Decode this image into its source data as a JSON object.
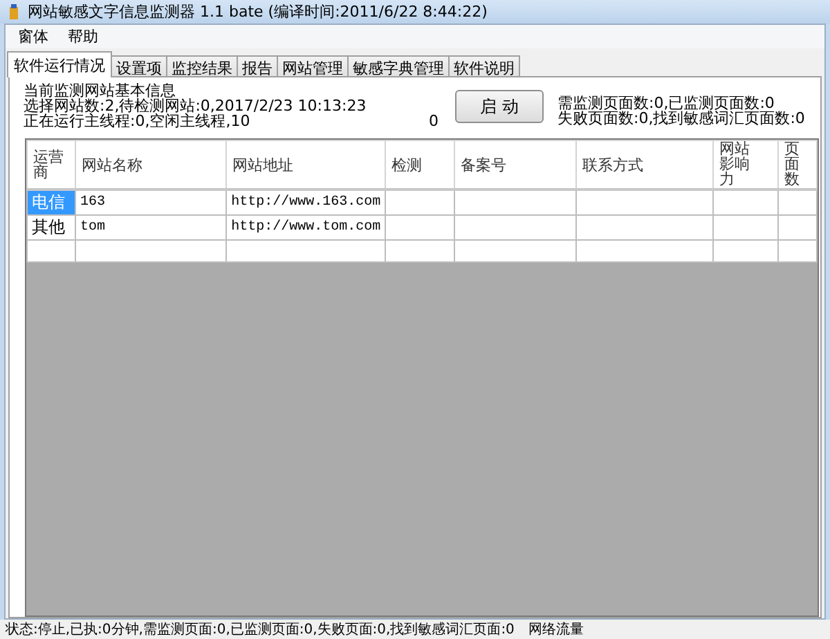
{
  "window": {
    "title": "网站敏感文字信息监测器 1.1 bate (编译时间:2011/6/22 8:44:22)"
  },
  "menu": [
    "窗体",
    "帮助"
  ],
  "tabs": [
    {
      "label": "软件运行情况",
      "selected": true
    },
    {
      "label": "设置项",
      "selected": false
    },
    {
      "label": "监控结果",
      "selected": false
    },
    {
      "label": "报告",
      "selected": false
    },
    {
      "label": "网站管理",
      "selected": false
    },
    {
      "label": "敏感字典管理",
      "selected": false
    },
    {
      "label": "软件说明",
      "selected": false
    }
  ],
  "info": {
    "heading": "当前监测网站基本信息",
    "line_1": "选择网站数:2,待检测网站:0,2017/2/23 10:13:23",
    "line_2": "正在运行主线程:0,空闲主线程,10",
    "thread_count": "0",
    "start_button": "启 动",
    "pages_line_1": "需监测页面数:0,已监测页面数:0",
    "pages_line_2": "失败页面数:0,找到敏感词汇页面数:0"
  },
  "grid": {
    "columns": [
      "运营商",
      "网站名称",
      "网站地址",
      "检测",
      "备案号",
      "联系方式",
      "网站影响力",
      "页面数"
    ],
    "rows": [
      {
        "carrier": {
          "text": "电信",
          "selected": true
        },
        "name": "163",
        "url": "http://www.163.com"
      },
      {
        "carrier": {
          "text": "其他",
          "selected": false
        },
        "name": "tom",
        "url": "http://www.tom.com"
      }
    ],
    "new_row": true
  },
  "status_bar": {
    "status": "状态:停止,已执:0分钟,需监测页面:0,已监测页面:0,失败页面:0,找到敏感词汇页面:0",
    "traffic": "网络流量"
  }
}
